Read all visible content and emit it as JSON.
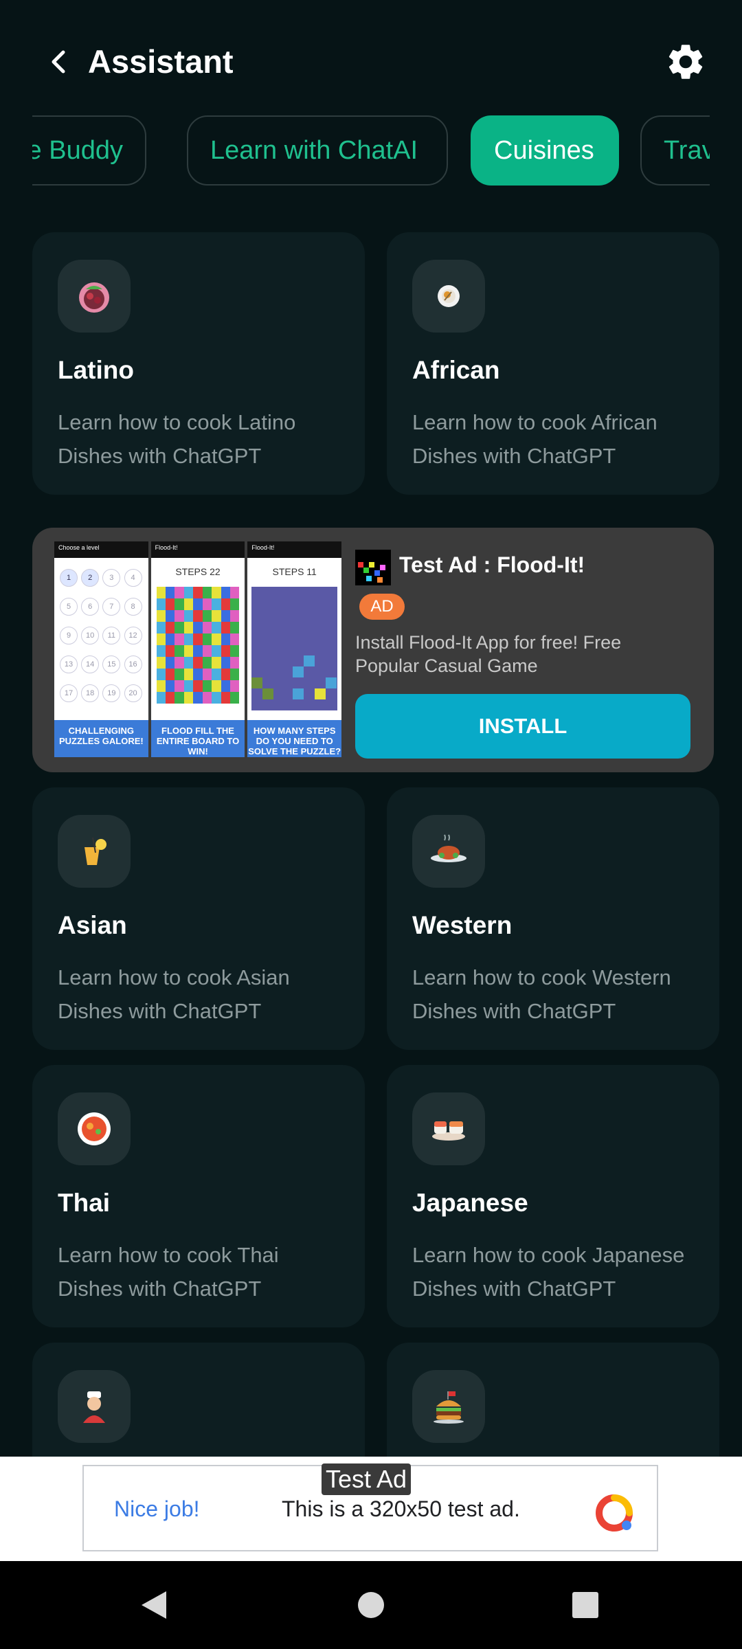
{
  "header": {
    "title": "Assistant"
  },
  "tabs": [
    {
      "label": "Lifestyle Buddy",
      "visible_label": "yle Buddy"
    },
    {
      "label": "Learn with ChatAI"
    },
    {
      "label": "Cuisines",
      "active": true
    },
    {
      "label": "Trav"
    }
  ],
  "cards": [
    {
      "name": "Latino",
      "desc": "Learn how to cook Latino Dishes with ChatGPT",
      "icon": "fruit-bowl-icon"
    },
    {
      "name": "African",
      "desc": "Learn how to cook African Dishes with ChatGPT",
      "icon": "plate-dish-icon"
    },
    {
      "name": "Asian",
      "desc": "Learn how to cook Asian Dishes with ChatGPT",
      "icon": "drink-icon"
    },
    {
      "name": "Western",
      "desc": "Learn how to cook Western Dishes with ChatGPT",
      "icon": "roast-chicken-icon"
    },
    {
      "name": "Thai",
      "desc": "Learn how to cook Thai Dishes with ChatGPT",
      "icon": "soup-bowl-icon"
    },
    {
      "name": "Japanese",
      "desc": "Learn how to cook Japanese Dishes with ChatGPT",
      "icon": "sushi-icon"
    },
    {
      "name": "",
      "desc": "",
      "icon": "chef-icon"
    },
    {
      "name": "",
      "desc": "",
      "icon": "burger-icon"
    }
  ],
  "native_ad": {
    "title": "Test Ad : Flood-It!",
    "badge": "AD",
    "description": "Install Flood-It App for free! Free Popular Casual Game",
    "cta": "INSTALL",
    "logo_text": "Flood-It!",
    "screenshots": [
      {
        "topbar": "Choose a level",
        "caption": "CHALLENGING PUZZLES GALORE!"
      },
      {
        "topbar": "Flood-It!",
        "steps": "STEPS 22",
        "caption": "FLOOD FILL THE ENTIRE BOARD TO WIN!"
      },
      {
        "topbar": "Flood-It!",
        "steps": "STEPS 11",
        "caption": "HOW MANY STEPS DO YOU NEED TO SOLVE THE PUZZLE?"
      }
    ],
    "levels": [
      "1",
      "2",
      "3",
      "4",
      "5",
      "6",
      "7",
      "8",
      "9",
      "10",
      "11",
      "12",
      "13",
      "14",
      "15",
      "16",
      "17",
      "18",
      "19",
      "20"
    ]
  },
  "banner_ad": {
    "label": "Test Ad",
    "left_text": "Nice job!",
    "message": "This is a 320x50 test ad."
  },
  "colors": {
    "background": "#061416",
    "card": "#0d1e21",
    "accent": "#0ab386",
    "tab_text": "#1fc08e",
    "install": "#08aac8",
    "ad_badge": "#f27a3a"
  }
}
